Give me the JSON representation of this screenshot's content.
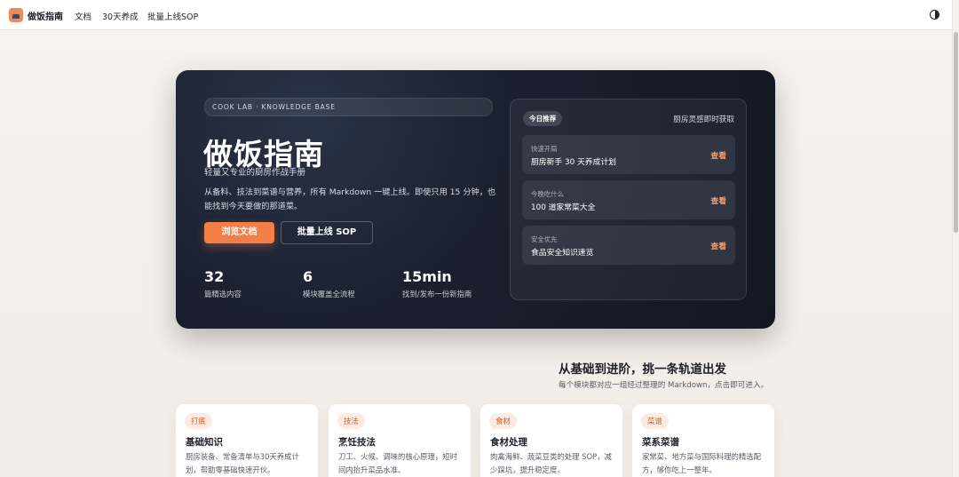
{
  "header": {
    "site_name": "做饭指南",
    "nav": [
      "文档",
      "30天养成",
      "批量上线SOP"
    ],
    "theme_toggle_icon": "contrast-icon"
  },
  "hero": {
    "pill": "COOK LAB · KNOWLEDGE BASE",
    "title": "做饭指南",
    "subtitle": "轻量又专业的厨房作战手册",
    "description": "从备料、技法到菜谱与营养，所有 Markdown 一键上线。即使只用 15 分钟，也能找到今天要做的那道菜。",
    "primary_button": "浏览文档",
    "secondary_button": "批量上线 SOP",
    "stats": [
      {
        "value": "32",
        "label": "篇精选内容"
      },
      {
        "value": "6",
        "label": "模块覆盖全流程"
      },
      {
        "value": "15min",
        "label": "找到/发布一份新指南"
      }
    ],
    "recommend": {
      "badge": "今日推荐",
      "header_right": "厨房灵感即时获取",
      "items": [
        {
          "tag": "快速开局",
          "title": "厨房新手 30 天养成计划",
          "action": "查看"
        },
        {
          "tag": "今晚吃什么",
          "title": "100 道家常菜大全",
          "action": "查看"
        },
        {
          "tag": "安全优先",
          "title": "食品安全知识速览",
          "action": "查看"
        }
      ]
    }
  },
  "section": {
    "title": "从基础到进阶，挑一条轨道出发",
    "subtitle": "每个模块都对应一组经过整理的 Markdown，点击即可进入。"
  },
  "cards": [
    {
      "tag": "打底",
      "title": "基础知识",
      "desc": "厨房装备、常备清单与30天养成计划，帮助零基础快速开伙。"
    },
    {
      "tag": "技法",
      "title": "烹饪技法",
      "desc": "刀工、火候、调味的核心原理，短时间内抬升菜品水准。"
    },
    {
      "tag": "食材",
      "title": "食材处理",
      "desc": "肉禽海鲜、蔬菜豆类的处理 SOP，减少踩坑，提升稳定度。"
    },
    {
      "tag": "菜谱",
      "title": "菜系菜谱",
      "desc": "家常菜、地方菜与国际料理的精选配方，够你吃上一整年。"
    }
  ],
  "colors": {
    "accent": "#f47f46",
    "hero_bg": "#151b29",
    "tag_bg": "#fcebe0",
    "tag_text": "#c7602c"
  }
}
